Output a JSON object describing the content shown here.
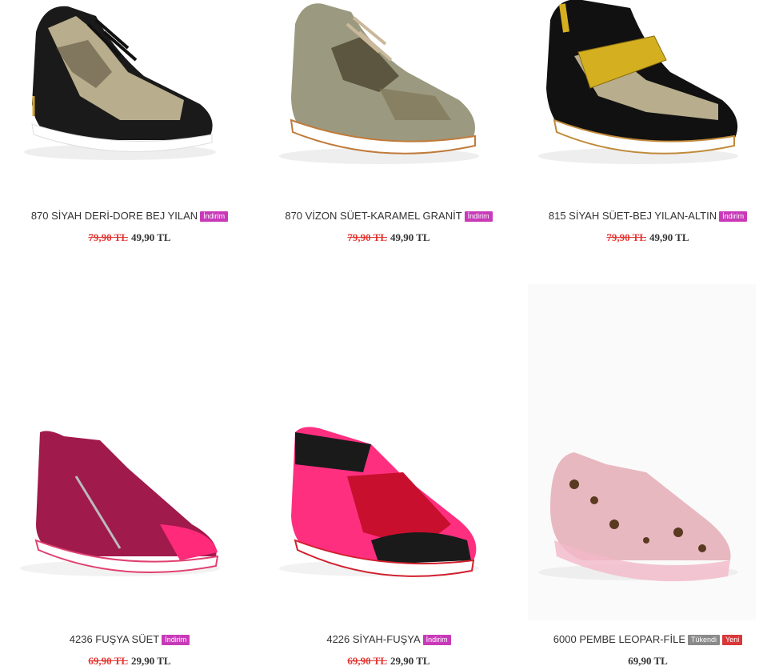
{
  "products": [
    {
      "name": "870 SİYAH DERİ-DORE BEJ YILAN",
      "badges": [
        {
          "label": "İndirim",
          "color": "#c83ab8"
        }
      ],
      "old_price": "79,90 TL",
      "price": "49,90 TL"
    },
    {
      "name": "870 VİZON SÜET-KARAMEL GRANİT",
      "badges": [
        {
          "label": "İndirim",
          "color": "#c83ab8"
        }
      ],
      "old_price": "79,90 TL",
      "price": "49,90 TL"
    },
    {
      "name": "815 SİYAH SÜET-BEJ YILAN-ALTIN",
      "badges": [
        {
          "label": "İndirim",
          "color": "#c83ab8"
        }
      ],
      "old_price": "79,90 TL",
      "price": "49,90 TL"
    },
    {
      "name": "4236 FUŞYA SÜET",
      "badges": [
        {
          "label": "İndirim",
          "color": "#c83ab8"
        }
      ],
      "old_price": "69,90 TL",
      "price": "29,90 TL"
    },
    {
      "name": "4226 SİYAH-FUŞYA",
      "badges": [
        {
          "label": "İndirim",
          "color": "#c83ab8"
        }
      ],
      "old_price": "69,90 TL",
      "price": "29,90 TL"
    },
    {
      "name": "6000 PEMBE LEOPAR-FİLE",
      "badges": [
        {
          "label": "Tükendi",
          "color": "#8a8a8a"
        },
        {
          "label": "Yeni",
          "color": "#d9383a"
        }
      ],
      "old_price": "",
      "price": "69,90 TL"
    }
  ],
  "colors": {
    "old_price": "#e53935",
    "discount_badge": "#c83ab8",
    "sold_out_badge": "#8a8a8a",
    "new_badge": "#d9383a"
  },
  "images": [
    "black-snake-sneaker",
    "mink-suede-sneaker",
    "black-gold-strap-sneaker",
    "fuchsia-suede-zip-sneaker",
    "black-fuchsia-zip-sneaker",
    "pink-leopard-mesh-sneaker"
  ]
}
